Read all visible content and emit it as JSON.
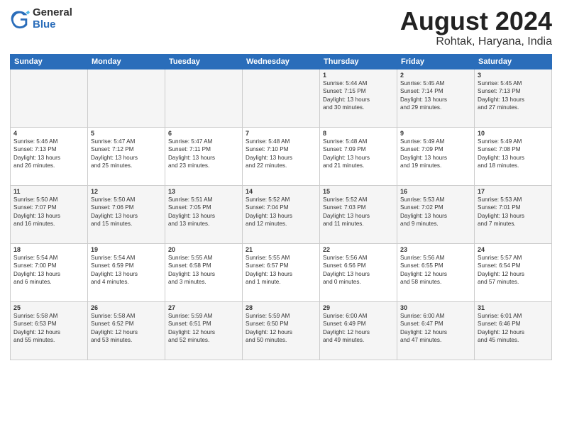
{
  "logo": {
    "general": "General",
    "blue": "Blue"
  },
  "title": "August 2024",
  "location": "Rohtak, Haryana, India",
  "days_of_week": [
    "Sunday",
    "Monday",
    "Tuesday",
    "Wednesday",
    "Thursday",
    "Friday",
    "Saturday"
  ],
  "weeks": [
    [
      {
        "day": "",
        "content": ""
      },
      {
        "day": "",
        "content": ""
      },
      {
        "day": "",
        "content": ""
      },
      {
        "day": "",
        "content": ""
      },
      {
        "day": "1",
        "content": "Sunrise: 5:44 AM\nSunset: 7:15 PM\nDaylight: 13 hours\nand 30 minutes."
      },
      {
        "day": "2",
        "content": "Sunrise: 5:45 AM\nSunset: 7:14 PM\nDaylight: 13 hours\nand 29 minutes."
      },
      {
        "day": "3",
        "content": "Sunrise: 5:45 AM\nSunset: 7:13 PM\nDaylight: 13 hours\nand 27 minutes."
      }
    ],
    [
      {
        "day": "4",
        "content": "Sunrise: 5:46 AM\nSunset: 7:13 PM\nDaylight: 13 hours\nand 26 minutes."
      },
      {
        "day": "5",
        "content": "Sunrise: 5:47 AM\nSunset: 7:12 PM\nDaylight: 13 hours\nand 25 minutes."
      },
      {
        "day": "6",
        "content": "Sunrise: 5:47 AM\nSunset: 7:11 PM\nDaylight: 13 hours\nand 23 minutes."
      },
      {
        "day": "7",
        "content": "Sunrise: 5:48 AM\nSunset: 7:10 PM\nDaylight: 13 hours\nand 22 minutes."
      },
      {
        "day": "8",
        "content": "Sunrise: 5:48 AM\nSunset: 7:09 PM\nDaylight: 13 hours\nand 21 minutes."
      },
      {
        "day": "9",
        "content": "Sunrise: 5:49 AM\nSunset: 7:09 PM\nDaylight: 13 hours\nand 19 minutes."
      },
      {
        "day": "10",
        "content": "Sunrise: 5:49 AM\nSunset: 7:08 PM\nDaylight: 13 hours\nand 18 minutes."
      }
    ],
    [
      {
        "day": "11",
        "content": "Sunrise: 5:50 AM\nSunset: 7:07 PM\nDaylight: 13 hours\nand 16 minutes."
      },
      {
        "day": "12",
        "content": "Sunrise: 5:50 AM\nSunset: 7:06 PM\nDaylight: 13 hours\nand 15 minutes."
      },
      {
        "day": "13",
        "content": "Sunrise: 5:51 AM\nSunset: 7:05 PM\nDaylight: 13 hours\nand 13 minutes."
      },
      {
        "day": "14",
        "content": "Sunrise: 5:52 AM\nSunset: 7:04 PM\nDaylight: 13 hours\nand 12 minutes."
      },
      {
        "day": "15",
        "content": "Sunrise: 5:52 AM\nSunset: 7:03 PM\nDaylight: 13 hours\nand 11 minutes."
      },
      {
        "day": "16",
        "content": "Sunrise: 5:53 AM\nSunset: 7:02 PM\nDaylight: 13 hours\nand 9 minutes."
      },
      {
        "day": "17",
        "content": "Sunrise: 5:53 AM\nSunset: 7:01 PM\nDaylight: 13 hours\nand 7 minutes."
      }
    ],
    [
      {
        "day": "18",
        "content": "Sunrise: 5:54 AM\nSunset: 7:00 PM\nDaylight: 13 hours\nand 6 minutes."
      },
      {
        "day": "19",
        "content": "Sunrise: 5:54 AM\nSunset: 6:59 PM\nDaylight: 13 hours\nand 4 minutes."
      },
      {
        "day": "20",
        "content": "Sunrise: 5:55 AM\nSunset: 6:58 PM\nDaylight: 13 hours\nand 3 minutes."
      },
      {
        "day": "21",
        "content": "Sunrise: 5:55 AM\nSunset: 6:57 PM\nDaylight: 13 hours\nand 1 minute."
      },
      {
        "day": "22",
        "content": "Sunrise: 5:56 AM\nSunset: 6:56 PM\nDaylight: 13 hours\nand 0 minutes."
      },
      {
        "day": "23",
        "content": "Sunrise: 5:56 AM\nSunset: 6:55 PM\nDaylight: 12 hours\nand 58 minutes."
      },
      {
        "day": "24",
        "content": "Sunrise: 5:57 AM\nSunset: 6:54 PM\nDaylight: 12 hours\nand 57 minutes."
      }
    ],
    [
      {
        "day": "25",
        "content": "Sunrise: 5:58 AM\nSunset: 6:53 PM\nDaylight: 12 hours\nand 55 minutes."
      },
      {
        "day": "26",
        "content": "Sunrise: 5:58 AM\nSunset: 6:52 PM\nDaylight: 12 hours\nand 53 minutes."
      },
      {
        "day": "27",
        "content": "Sunrise: 5:59 AM\nSunset: 6:51 PM\nDaylight: 12 hours\nand 52 minutes."
      },
      {
        "day": "28",
        "content": "Sunrise: 5:59 AM\nSunset: 6:50 PM\nDaylight: 12 hours\nand 50 minutes."
      },
      {
        "day": "29",
        "content": "Sunrise: 6:00 AM\nSunset: 6:49 PM\nDaylight: 12 hours\nand 49 minutes."
      },
      {
        "day": "30",
        "content": "Sunrise: 6:00 AM\nSunset: 6:47 PM\nDaylight: 12 hours\nand 47 minutes."
      },
      {
        "day": "31",
        "content": "Sunrise: 6:01 AM\nSunset: 6:46 PM\nDaylight: 12 hours\nand 45 minutes."
      }
    ]
  ]
}
